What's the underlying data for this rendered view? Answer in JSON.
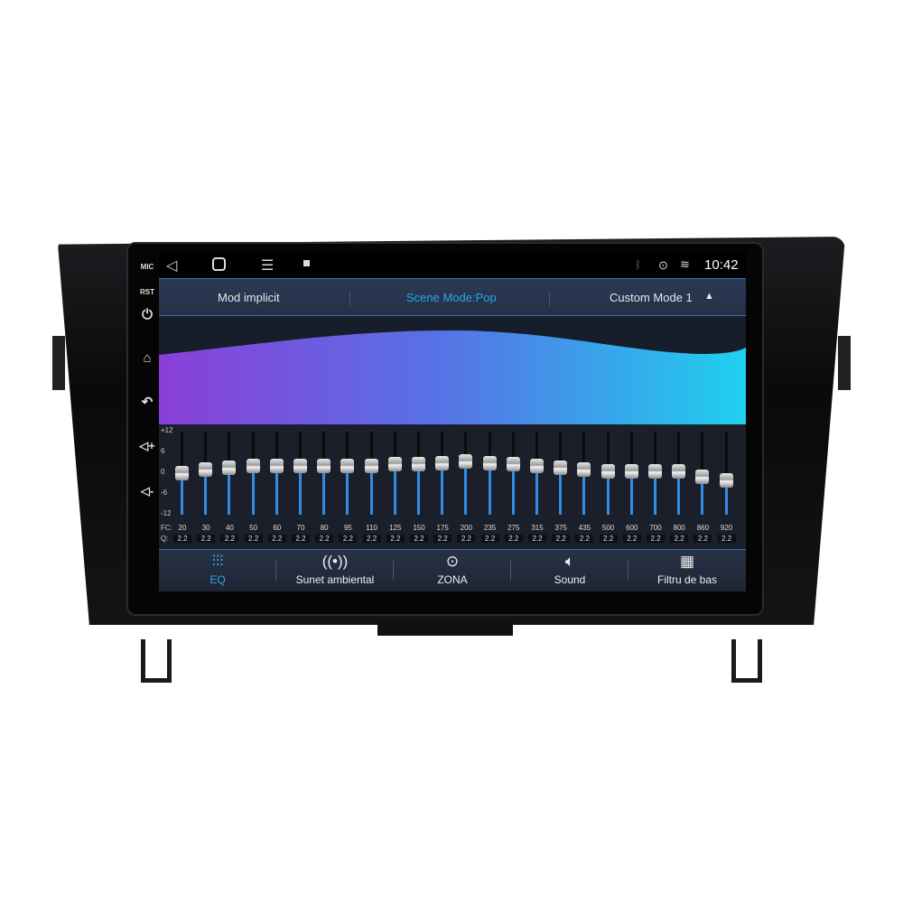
{
  "side_buttons": [
    {
      "label": "MIC"
    },
    {
      "label": "RST"
    },
    {
      "icon": "power-icon"
    },
    {
      "icon": "home-icon"
    },
    {
      "icon": "back-icon"
    },
    {
      "icon": "volume-up-icon"
    },
    {
      "icon": "volume-down-icon"
    }
  ],
  "status": {
    "time": "10:42",
    "icons": [
      "back-icon",
      "home-icon",
      "menu-icon",
      "gallery-icon",
      "bluetooth-icon",
      "location-icon",
      "wifi-icon"
    ]
  },
  "header": {
    "left": "Mod implicit",
    "center": "Scene Mode:Pop",
    "right": "Custom Mode 1",
    "accent": "#2aa7ec"
  },
  "eq": {
    "scale": [
      "+12",
      "6",
      "0",
      "-6",
      "-12"
    ],
    "fc_label": "FC:",
    "q_label": "Q:",
    "bands": [
      {
        "fc": "20",
        "q": "2.2",
        "gain": 0
      },
      {
        "fc": "30",
        "q": "2.2",
        "gain": 1
      },
      {
        "fc": "40",
        "q": "2.2",
        "gain": 1.5
      },
      {
        "fc": "50",
        "q": "2.2",
        "gain": 2
      },
      {
        "fc": "60",
        "q": "2.2",
        "gain": 2
      },
      {
        "fc": "70",
        "q": "2.2",
        "gain": 2
      },
      {
        "fc": "80",
        "q": "2.2",
        "gain": 2
      },
      {
        "fc": "95",
        "q": "2.2",
        "gain": 2
      },
      {
        "fc": "110",
        "q": "2.2",
        "gain": 2
      },
      {
        "fc": "125",
        "q": "2.2",
        "gain": 2.5
      },
      {
        "fc": "150",
        "q": "2.2",
        "gain": 2.5
      },
      {
        "fc": "175",
        "q": "2.2",
        "gain": 3
      },
      {
        "fc": "200",
        "q": "2.2",
        "gain": 3.5
      },
      {
        "fc": "235",
        "q": "2.2",
        "gain": 3
      },
      {
        "fc": "275",
        "q": "2.2",
        "gain": 2.5
      },
      {
        "fc": "315",
        "q": "2.2",
        "gain": 2
      },
      {
        "fc": "375",
        "q": "2.2",
        "gain": 1.5
      },
      {
        "fc": "435",
        "q": "2.2",
        "gain": 1
      },
      {
        "fc": "500",
        "q": "2.2",
        "gain": 0.5
      },
      {
        "fc": "600",
        "q": "2.2",
        "gain": 0.5
      },
      {
        "fc": "700",
        "q": "2.2",
        "gain": 0.5
      },
      {
        "fc": "800",
        "q": "2.2",
        "gain": 0.5
      },
      {
        "fc": "860",
        "q": "2.2",
        "gain": -1
      },
      {
        "fc": "920",
        "q": "2.2",
        "gain": -2
      }
    ]
  },
  "tabs": [
    {
      "label": "EQ",
      "icon": "equalizer-icon",
      "active": true
    },
    {
      "label": "Sunet ambiental",
      "icon": "surround-icon"
    },
    {
      "label": "ZONA",
      "icon": "zone-target-icon"
    },
    {
      "label": "Sound",
      "icon": "speaker-icon"
    },
    {
      "label": "Filtru de bas",
      "icon": "bass-filter-icon"
    }
  ]
}
